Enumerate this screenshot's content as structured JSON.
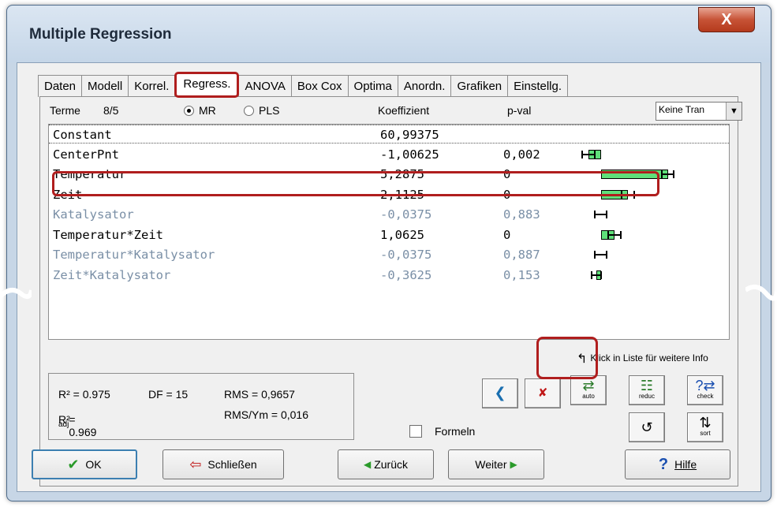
{
  "window": {
    "title": "Multiple Regression",
    "close": "X"
  },
  "tabs": [
    {
      "label": "Daten"
    },
    {
      "label": "Modell"
    },
    {
      "label": "Korrel."
    },
    {
      "label": "Regress."
    },
    {
      "label": "ANOVA"
    },
    {
      "label": "Box Cox"
    },
    {
      "label": "Optima"
    },
    {
      "label": "Anordn."
    },
    {
      "label": "Grafiken"
    },
    {
      "label": "Einstellg."
    }
  ],
  "header": {
    "terme_label": "Terme",
    "terme_count": "8/5",
    "mode_mr": "MR",
    "mode_pls": "PLS",
    "koeffizient": "Koeffizient",
    "pval": "p-val",
    "transform": "Keine Tran"
  },
  "terms": [
    {
      "name": "Constant",
      "coef": "60,99375",
      "pval": "",
      "significant": true,
      "bar": null
    },
    {
      "name": "CenterPnt",
      "coef": "-1,00625",
      "pval": "0,002",
      "significant": true,
      "bar": {
        "value": -1.00625,
        "err": 0.55
      }
    },
    {
      "name": "Temperatur",
      "coef": "5,2875",
      "pval": "0",
      "significant": true,
      "bar": {
        "value": 5.2875,
        "err": 0.55
      }
    },
    {
      "name": "Zeit",
      "coef": "2,1125",
      "pval": "0",
      "significant": true,
      "bar": {
        "value": 2.1125,
        "err": 0.55
      }
    },
    {
      "name": "Katalysator",
      "coef": "-0,0375",
      "pval": "0,883",
      "significant": false,
      "bar": {
        "value": -0.0375,
        "err": 0.55
      }
    },
    {
      "name": "Temperatur*Zeit",
      "coef": "1,0625",
      "pval": "0",
      "significant": true,
      "bar": {
        "value": 1.0625,
        "err": 0.55
      }
    },
    {
      "name": "Temperatur*Katalysator",
      "coef": "-0,0375",
      "pval": "0,887",
      "significant": false,
      "bar": {
        "value": -0.0375,
        "err": 0.55
      }
    },
    {
      "name": "Zeit*Katalysator",
      "coef": "-0,3625",
      "pval": "0,153",
      "significant": false,
      "bar": {
        "value": -0.3625,
        "err": 0.45
      }
    }
  ],
  "info_hint": "Klick in Liste für weitere Info",
  "stats": {
    "r2": "R² = 0.975",
    "df": "DF = 15",
    "rms": "RMS = 0,9657",
    "r2adj_prefix": "R²",
    "r2adj_sub": "adj",
    "r2adj_value": "= 0.969",
    "rms_ym": "RMS/Ym = 0,016"
  },
  "tools": {
    "auto": "auto",
    "reduc": "reduc",
    "check": "check",
    "sort": "sort"
  },
  "formeln": "Formeln",
  "buttons": {
    "ok": "OK",
    "close": "Schließen",
    "back": "Zurück",
    "next": "Weiter",
    "help": "Hilfe"
  },
  "colors": {
    "bar_fill": "#5fe07a",
    "highlight": "#b01e1e",
    "insignificant_text": "#7a8fa6"
  }
}
